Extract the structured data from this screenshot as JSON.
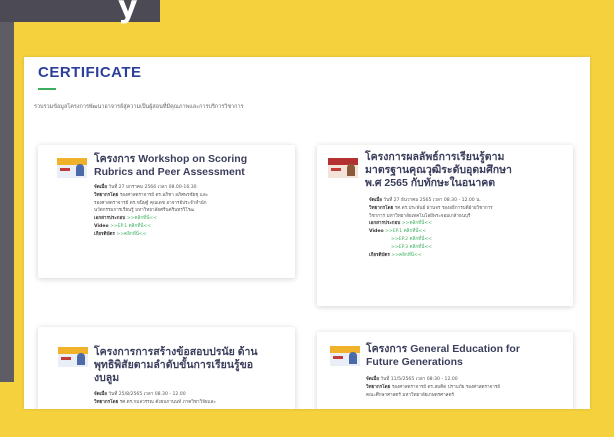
{
  "header": {
    "partial_glyph": "y"
  },
  "section": {
    "title": "CERTIFICATE",
    "subtitle": "รวบรวมข้อมูลโครงการพัฒนาอาจารย์สู่ความเป็นผู้สอนที่มีคุณภาพและการบริการวิชาการ"
  },
  "cards": [
    {
      "title_lines": [
        "โครงการ Workshop on Scoring",
        "Rubrics and Peer Assessment"
      ],
      "details": [
        {
          "label": "จัดเมื่อ",
          "text": "วันที่ 27 มกราคม 2566 เวลา 08.00-16.30"
        },
        {
          "label": "วิทยากรโดย",
          "text": "รองศาสตราจารย์ ดร.อภิชา อภิศพรชัยชุ และ"
        },
        {
          "label": "",
          "text": "รองศาสตราจารย์ ดร.ขนิษฐ์ คุณเดช อาจารย์ประจำสำนัก"
        },
        {
          "label": "",
          "text": "นวัตกรรมการเรียนรู้ มหาวิทยาลัยศรีนครินทรวิโรฒ"
        },
        {
          "label": "เอกสารประกอบ",
          "text": "",
          "link": ">>คลิกที่นี่<<"
        },
        {
          "label": "Video",
          "text": "",
          "link": ">>EP.1 คลิกที่นี่<<"
        },
        {
          "label": "เกียรติบัตร",
          "text": "",
          "link": ">>คลิกที่นี่<<"
        }
      ]
    },
    {
      "title_lines": [
        "โครงการผลลัพธ์การเรียนรู้ตาม",
        "มาตรฐานคุณวุฒิระดับอุดมศึกษา",
        "พ.ศ 2565 กับทักษะในอนาคต"
      ],
      "details": [
        {
          "label": "จัดเมื่อ",
          "text": "วันที่ 27 ธันวาคม 2565 เวลา 08.30 - 12.00 น."
        },
        {
          "label": "วิทยากรโดย",
          "text": "รศ.ดร.ประพันธ์ ผ่านจร รองอธิการบดีฝ่ายวิชาการ"
        },
        {
          "label": "",
          "text": "วิชาการ มหาวิทยาลัยเทคโนโลยีพระจอมเกล้าธนบุรี"
        },
        {
          "label": "เอกสารประกอบ",
          "text": "",
          "link": ">>คลิกที่นี่<<"
        },
        {
          "label": "Video",
          "text": "",
          "link": ">>EP.1 คลิกที่นี่<<"
        },
        {
          "label": "",
          "text": "",
          "link": ">>EP.2 คลิกที่นี่<<"
        },
        {
          "label": "",
          "text": "",
          "link": ">>EP.3 คลิกที่นี่<<"
        },
        {
          "label": "เกียรติบัตร",
          "text": "",
          "link": ">>คลิกที่นี่<<"
        }
      ]
    },
    {
      "title_lines": [
        "โครงการการสร้างข้อสอบปรนัย ด้าน",
        "พุทธิพิสัยตามลำดับขั้นการเรียนรู้ขอ",
        "งบลูม"
      ],
      "details": [
        {
          "label": "จัดเมื่อ",
          "text": "วันที่ 25/8/2565 เวลา 08.30 - 12.00"
        },
        {
          "label": "วิทยากรโดย",
          "text": "รศ.ดร.กมลวรรณ ตังธนกานนท์ ภาควิชาวิจัยและ"
        }
      ]
    },
    {
      "title_lines": [
        "โครงการ General Education for",
        "Future Generations"
      ],
      "details": [
        {
          "label": "จัดเมื่อ",
          "text": "วันที่ 11/5/2565 เวลา 08:30 - 12.00"
        },
        {
          "label": "วิทยากรโดย",
          "text": "รองศาสตราจารย์ ดร.สมคิด ปราบภัย รองศาสตราจารย์"
        },
        {
          "label": "",
          "text": "คณะศึกษาศาสตร์ มหาวิทยาลัยเกษตรศาสตร์"
        }
      ]
    }
  ]
}
